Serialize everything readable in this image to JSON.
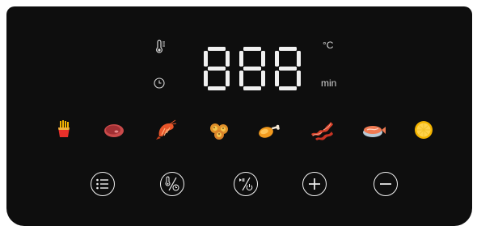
{
  "display": {
    "readout": "888",
    "temp_unit": "°C",
    "time_unit": "min"
  },
  "indicators": {
    "temperature": "thermometer-icon",
    "timer": "clock-icon"
  },
  "presets": [
    "fries-icon",
    "steak-icon",
    "shrimp-icon",
    "pastry-icon",
    "drumstick-icon",
    "bacon-icon",
    "fish-icon",
    "cake-icon"
  ],
  "controls": [
    "menu-icon",
    "temp-time-icon",
    "start-pause-power-icon",
    "plus-icon",
    "minus-icon"
  ],
  "colors": {
    "panel": "#0e0e0e",
    "segment": "#f0f0f0",
    "icon_line": "#f2f2f2"
  }
}
